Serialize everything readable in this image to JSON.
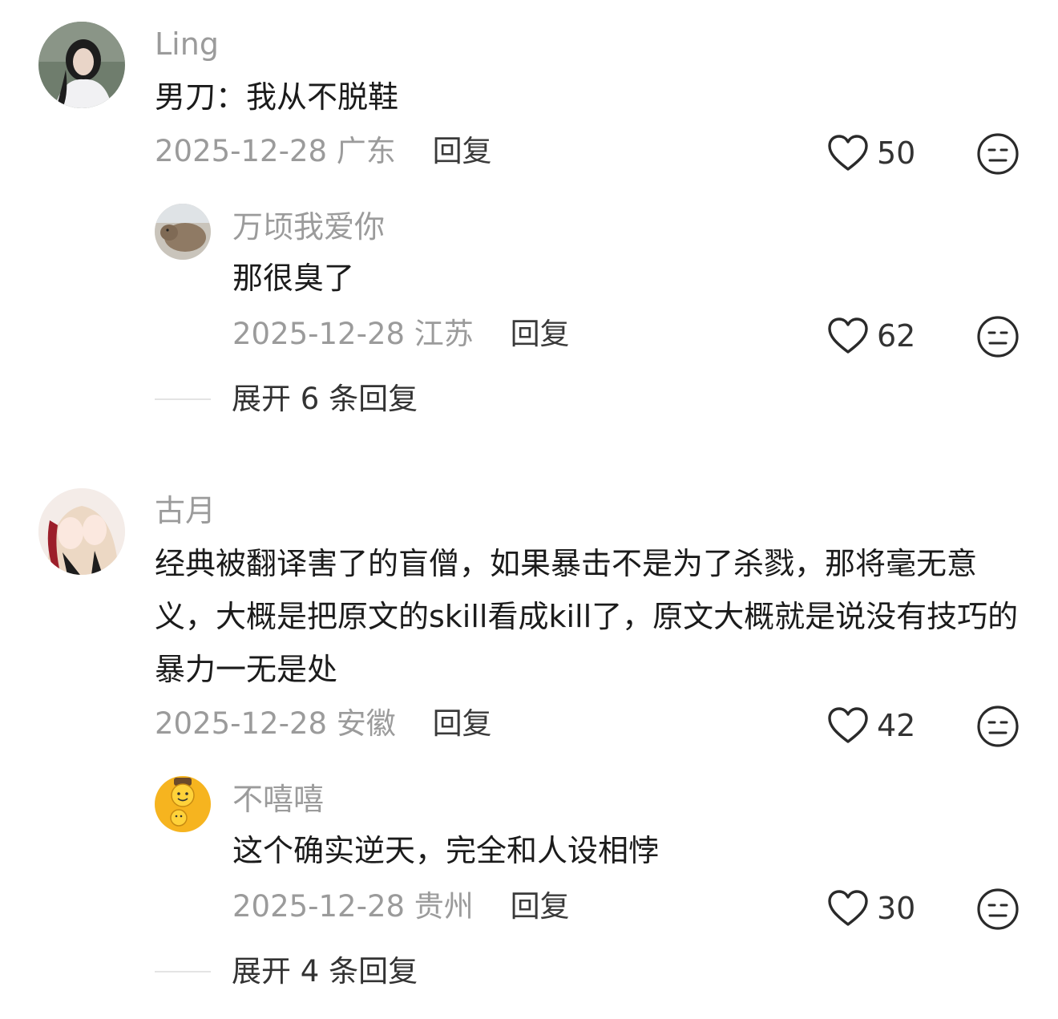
{
  "reply_label": "回复",
  "comments": [
    {
      "username": "Ling",
      "content": "男刀：我从不脱鞋",
      "date": "2025-12-28",
      "region": "广东",
      "likes": "50",
      "reply": {
        "username": "万顷我爱你",
        "content": "那很臭了",
        "date": "2025-12-28",
        "region": "江苏",
        "likes": "62"
      },
      "expand_label": "展开 6 条回复"
    },
    {
      "username": "古月",
      "content": "经典被翻译害了的盲僧，如果暴击不是为了杀戮，那将毫无意义，大概是把原文的skill看成kill了，原文大概就是说没有技巧的暴力一无是处",
      "date": "2025-12-28",
      "region": "安徽",
      "likes": "42",
      "reply": {
        "username": "不嘻嘻",
        "content": "这个确实逆天，完全和人设相悖",
        "date": "2025-12-28",
        "region": "贵州",
        "likes": "30"
      },
      "expand_label": "展开 4 条回复"
    }
  ]
}
